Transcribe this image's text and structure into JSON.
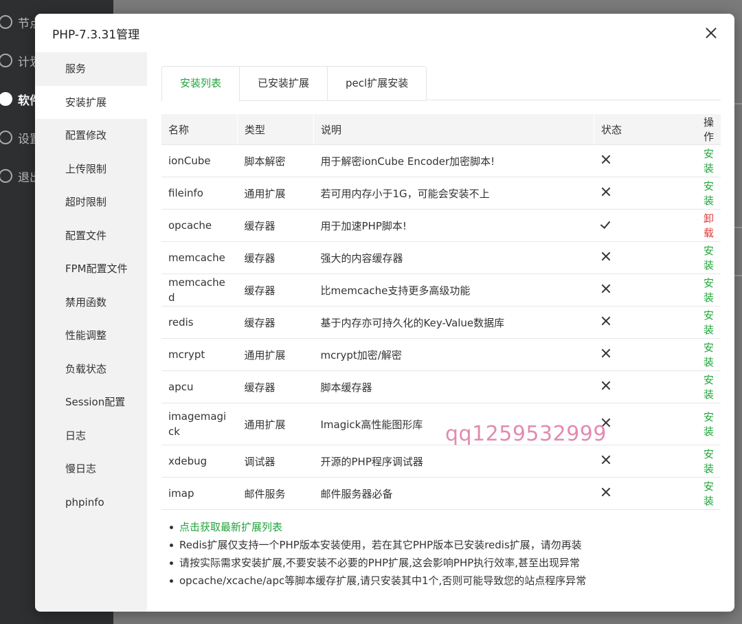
{
  "background": {
    "sidebar": [
      {
        "label": "节点"
      },
      {
        "label": "计划"
      },
      {
        "label": "软件"
      },
      {
        "label": "设置"
      },
      {
        "label": "退出"
      }
    ]
  },
  "modal": {
    "title": "PHP-7.3.31管理",
    "sidebar": [
      "服务",
      "安装扩展",
      "配置修改",
      "上传限制",
      "超时限制",
      "配置文件",
      "FPM配置文件",
      "禁用函数",
      "性能调整",
      "负载状态",
      "Session配置",
      "日志",
      "慢日志",
      "phpinfo"
    ],
    "active_sidebar": "安装扩展",
    "tabs": [
      "安装列表",
      "已安装扩展",
      "pecl扩展安装"
    ],
    "active_tab": "安装列表",
    "table": {
      "headers": [
        "名称",
        "类型",
        "说明",
        "状态",
        "操作"
      ],
      "rows": [
        {
          "name": "ionCube",
          "type": "脚本解密",
          "desc": "用于解密ionCube Encoder加密脚本!",
          "status": "x",
          "action": "安装"
        },
        {
          "name": "fileinfo",
          "type": "通用扩展",
          "desc": "若可用内存小于1G，可能会安装不上",
          "status": "x",
          "action": "安装"
        },
        {
          "name": "opcache",
          "type": "缓存器",
          "desc": "用于加速PHP脚本!",
          "status": "check",
          "action": "卸载"
        },
        {
          "name": "memcache",
          "type": "缓存器",
          "desc": "强大的内容缓存器",
          "status": "x",
          "action": "安装"
        },
        {
          "name": "memcached",
          "type": "缓存器",
          "desc": "比memcache支持更多高级功能",
          "status": "x",
          "action": "安装"
        },
        {
          "name": "redis",
          "type": "缓存器",
          "desc": "基于内存亦可持久化的Key-Value数据库",
          "status": "x",
          "action": "安装"
        },
        {
          "name": "mcrypt",
          "type": "通用扩展",
          "desc": "mcrypt加密/解密",
          "status": "x",
          "action": "安装"
        },
        {
          "name": "apcu",
          "type": "缓存器",
          "desc": "脚本缓存器",
          "status": "x",
          "action": "安装"
        },
        {
          "name": "imagemagick",
          "type": "通用扩展",
          "desc": "Imagick高性能图形库",
          "status": "x",
          "action": "安装"
        },
        {
          "name": "xdebug",
          "type": "调试器",
          "desc": "开源的PHP程序调试器",
          "status": "x",
          "action": "安装"
        },
        {
          "name": "imap",
          "type": "邮件服务",
          "desc": "邮件服务器必备",
          "status": "x",
          "action": "安装"
        }
      ]
    },
    "notes": [
      "点击获取最新扩展列表",
      "Redis扩展仅支持一个PHP版本安装使用，若在其它PHP版本已安装redis扩展，请勿再装",
      "请按实际需求安装扩展,不要安装不必要的PHP扩展,这会影响PHP执行效率,甚至出现异常",
      "opcache/xcache/apc等脚本缓存扩展,请只安装其中1个,否则可能导致您的站点程序异常"
    ]
  },
  "watermark": "qq1259532999",
  "colors": {
    "accent": "#20a53a",
    "danger": "#e03b3b"
  }
}
